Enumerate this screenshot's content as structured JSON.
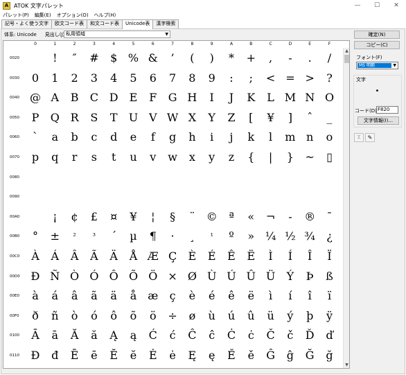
{
  "window": {
    "title": "ATOK 文字パレット",
    "icon": "A"
  },
  "menu": [
    "パレット(P)",
    "編集(E)",
    "オプション(O)",
    "ヘルプ(H)"
  ],
  "tabs": [
    {
      "label": "記号・よく使う文字",
      "active": false
    },
    {
      "label": "欧文コード表",
      "active": false
    },
    {
      "label": "和文コード表",
      "active": false
    },
    {
      "label": "Unicode表",
      "active": true
    },
    {
      "label": "漢字検索",
      "active": false
    }
  ],
  "filter": {
    "system_label": "体系:",
    "system_value": "Unicode",
    "heading_label": "見出し(J)",
    "heading_value": "私用領域"
  },
  "columns": [
    "0",
    "1",
    "2",
    "3",
    "4",
    "5",
    "6",
    "7",
    "8",
    "9",
    "A",
    "B",
    "C",
    "D",
    "E",
    "F"
  ],
  "rows": [
    {
      "code": "0020",
      "chars": [
        "",
        "!",
        "″",
        "#",
        "$",
        "%",
        "&",
        "’",
        "(",
        ")",
        "*",
        "+",
        ",",
        "-",
        ".",
        "/"
      ]
    },
    {
      "code": "0030",
      "chars": [
        "0",
        "1",
        "2",
        "3",
        "4",
        "5",
        "6",
        "7",
        "8",
        "9",
        ":",
        ";",
        "<",
        "=",
        ">",
        "?"
      ]
    },
    {
      "code": "0040",
      "chars": [
        "@",
        "A",
        "B",
        "C",
        "D",
        "E",
        "F",
        "G",
        "H",
        "I",
        "J",
        "K",
        "L",
        "M",
        "N",
        "O"
      ]
    },
    {
      "code": "0050",
      "chars": [
        "P",
        "Q",
        "R",
        "S",
        "T",
        "U",
        "V",
        "W",
        "X",
        "Y",
        "Z",
        "[",
        "¥",
        "]",
        "ˆ",
        "_"
      ]
    },
    {
      "code": "0060",
      "chars": [
        "`",
        "a",
        "b",
        "c",
        "d",
        "e",
        "f",
        "g",
        "h",
        "i",
        "j",
        "k",
        "l",
        "m",
        "n",
        "o"
      ]
    },
    {
      "code": "0070",
      "chars": [
        "p",
        "q",
        "r",
        "s",
        "t",
        "u",
        "v",
        "w",
        "x",
        "y",
        "z",
        "{",
        "|",
        "}",
        "~",
        "▯"
      ]
    },
    {
      "code": "0080",
      "chars": [
        "",
        "",
        "",
        "",
        "",
        "",
        "",
        "",
        "",
        "",
        "",
        "",
        "",
        "",
        "",
        ""
      ]
    },
    {
      "code": "0090",
      "chars": [
        "",
        "",
        "",
        "",
        "",
        "",
        "",
        "",
        "",
        "",
        "",
        "",
        "",
        "",
        "",
        ""
      ]
    },
    {
      "code": "00A0",
      "chars": [
        "",
        "¡",
        "¢",
        "£",
        "¤",
        "¥",
        "¦",
        "§",
        "¨",
        "©",
        "ª",
        "«",
        "¬",
        "-",
        "®",
        "¯"
      ]
    },
    {
      "code": "00B0",
      "chars": [
        "°",
        "±",
        "²",
        "³",
        "´",
        "µ",
        "¶",
        "·",
        "¸",
        "¹",
        "º",
        "»",
        "¼",
        "½",
        "¾",
        "¿"
      ]
    },
    {
      "code": "00C0",
      "chars": [
        "À",
        "Á",
        "Â",
        "Ã",
        "Ä",
        "Å",
        "Æ",
        "Ç",
        "È",
        "É",
        "Ê",
        "Ë",
        "Ì",
        "Í",
        "Î",
        "Ï"
      ]
    },
    {
      "code": "00D0",
      "chars": [
        "Ð",
        "Ñ",
        "Ò",
        "Ó",
        "Ô",
        "Õ",
        "Ö",
        "×",
        "Ø",
        "Ù",
        "Ú",
        "Û",
        "Ü",
        "Ý",
        "Þ",
        "ß"
      ]
    },
    {
      "code": "00E0",
      "chars": [
        "à",
        "á",
        "â",
        "ã",
        "ä",
        "å",
        "æ",
        "ç",
        "è",
        "é",
        "ê",
        "ë",
        "ì",
        "í",
        "î",
        "ï"
      ]
    },
    {
      "code": "00F0",
      "chars": [
        "ð",
        "ñ",
        "ò",
        "ó",
        "ô",
        "õ",
        "ö",
        "÷",
        "ø",
        "ù",
        "ú",
        "û",
        "ü",
        "ý",
        "þ",
        "ÿ"
      ]
    },
    {
      "code": "0100",
      "chars": [
        "Ā",
        "ā",
        "Ă",
        "ă",
        "Ą",
        "ą",
        "Ć",
        "ć",
        "Ĉ",
        "ĉ",
        "Ċ",
        "ċ",
        "Č",
        "č",
        "Ď",
        "ď"
      ]
    },
    {
      "code": "0110",
      "chars": [
        "Đ",
        "đ",
        "Ē",
        "ē",
        "Ĕ",
        "ĕ",
        "Ė",
        "ė",
        "Ę",
        "ę",
        "Ě",
        "ě",
        "Ĝ",
        "ĝ",
        "Ğ",
        "ğ"
      ]
    }
  ],
  "side": {
    "confirm_button": "確定(N)",
    "copy_button": "コピー(C)",
    "font_label": "フォント(F)",
    "font_value": "MS 明朝",
    "char_label": "文字",
    "preview_char": "•",
    "code_label": "コード(D)",
    "code_value": "F820",
    "char_info_button": "文字情報(I)..."
  }
}
